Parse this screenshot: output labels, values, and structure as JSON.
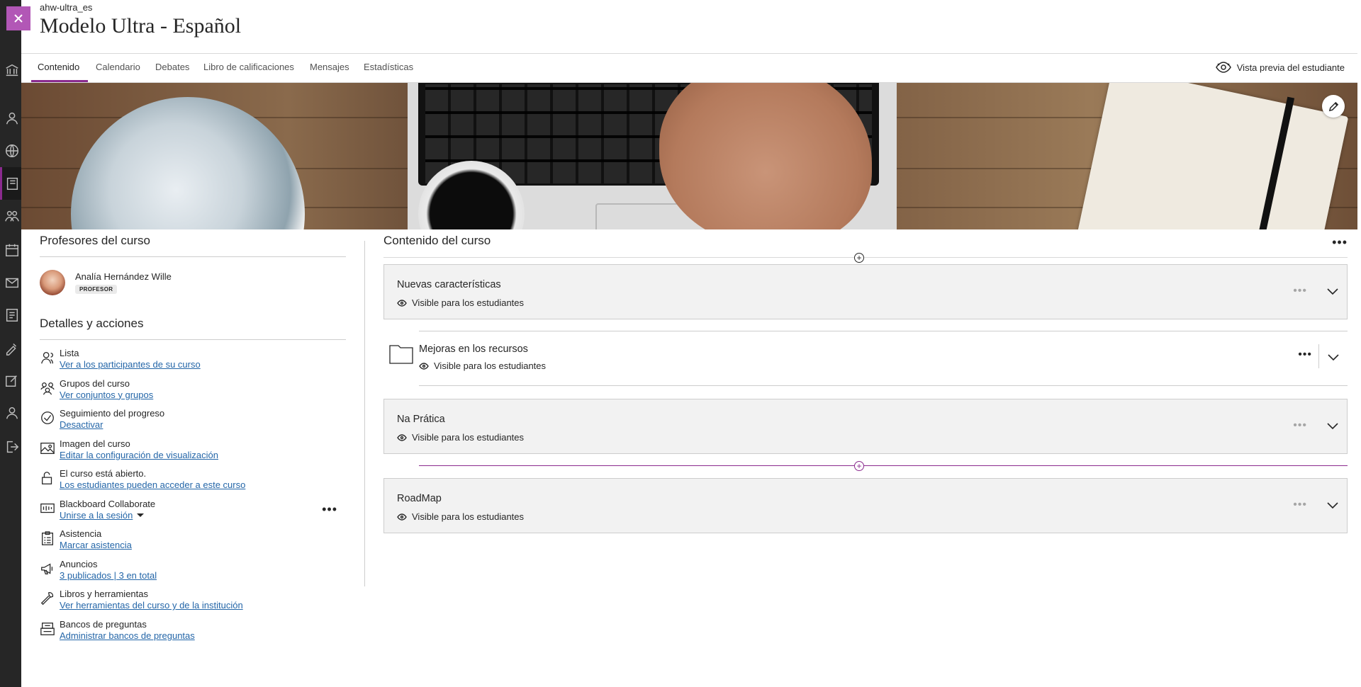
{
  "course": {
    "id": "ahw-ultra_es",
    "title": "Modelo Ultra - Español"
  },
  "tabs": [
    {
      "label": "Contenido"
    },
    {
      "label": "Calendario"
    },
    {
      "label": "Debates"
    },
    {
      "label": "Libro de calificaciones"
    },
    {
      "label": "Mensajes"
    },
    {
      "label": "Estadísticas"
    }
  ],
  "student_preview": "Vista previa del estudiante",
  "instructors": {
    "heading": "Profesores del curso",
    "name": "Analía Hernández Wille",
    "role": "PROFESOR"
  },
  "details": {
    "heading": "Detalles y acciones",
    "items": [
      {
        "icon": "roster-icon",
        "label": "Lista",
        "link": "Ver a los participantes de su curso"
      },
      {
        "icon": "groups-icon",
        "label": "Grupos del curso",
        "link": "Ver conjuntos y grupos"
      },
      {
        "icon": "progress-check-icon",
        "label": "Seguimiento del progreso",
        "link": "Desactivar"
      },
      {
        "icon": "image-icon",
        "label": "Imagen del curso",
        "link": "Editar la configuración de visualización"
      },
      {
        "icon": "unlock-icon",
        "label": "El curso está abierto.",
        "link": "Los estudiantes pueden acceder a este curso"
      },
      {
        "icon": "collaborate-icon",
        "label": "Blackboard Collaborate",
        "link": "Unirse a la sesión"
      },
      {
        "icon": "attendance-icon",
        "label": "Asistencia",
        "link": "Marcar asistencia"
      },
      {
        "icon": "megaphone-icon",
        "label": "Anuncios",
        "link": "3 publicados | 3 en total"
      },
      {
        "icon": "wrench-icon",
        "label": "Libros y herramientas",
        "link": "Ver herramientas del curso y de la institución"
      },
      {
        "icon": "question-bank-icon",
        "label": "Bancos de preguntas",
        "link": "Administrar bancos de preguntas"
      }
    ]
  },
  "content": {
    "heading": "Contenido del curso",
    "visibility": "Visible para los estudiantes",
    "modules": [
      {
        "title": "Nuevas características"
      },
      {
        "title": "Mejoras en los recursos"
      },
      {
        "title": "Na Prática"
      },
      {
        "title": "RoadMap"
      }
    ]
  },
  "colors": {
    "accent": "#8a2a8e",
    "close_button": "#b257b6",
    "link": "#2466a8",
    "rail": "#262626"
  }
}
